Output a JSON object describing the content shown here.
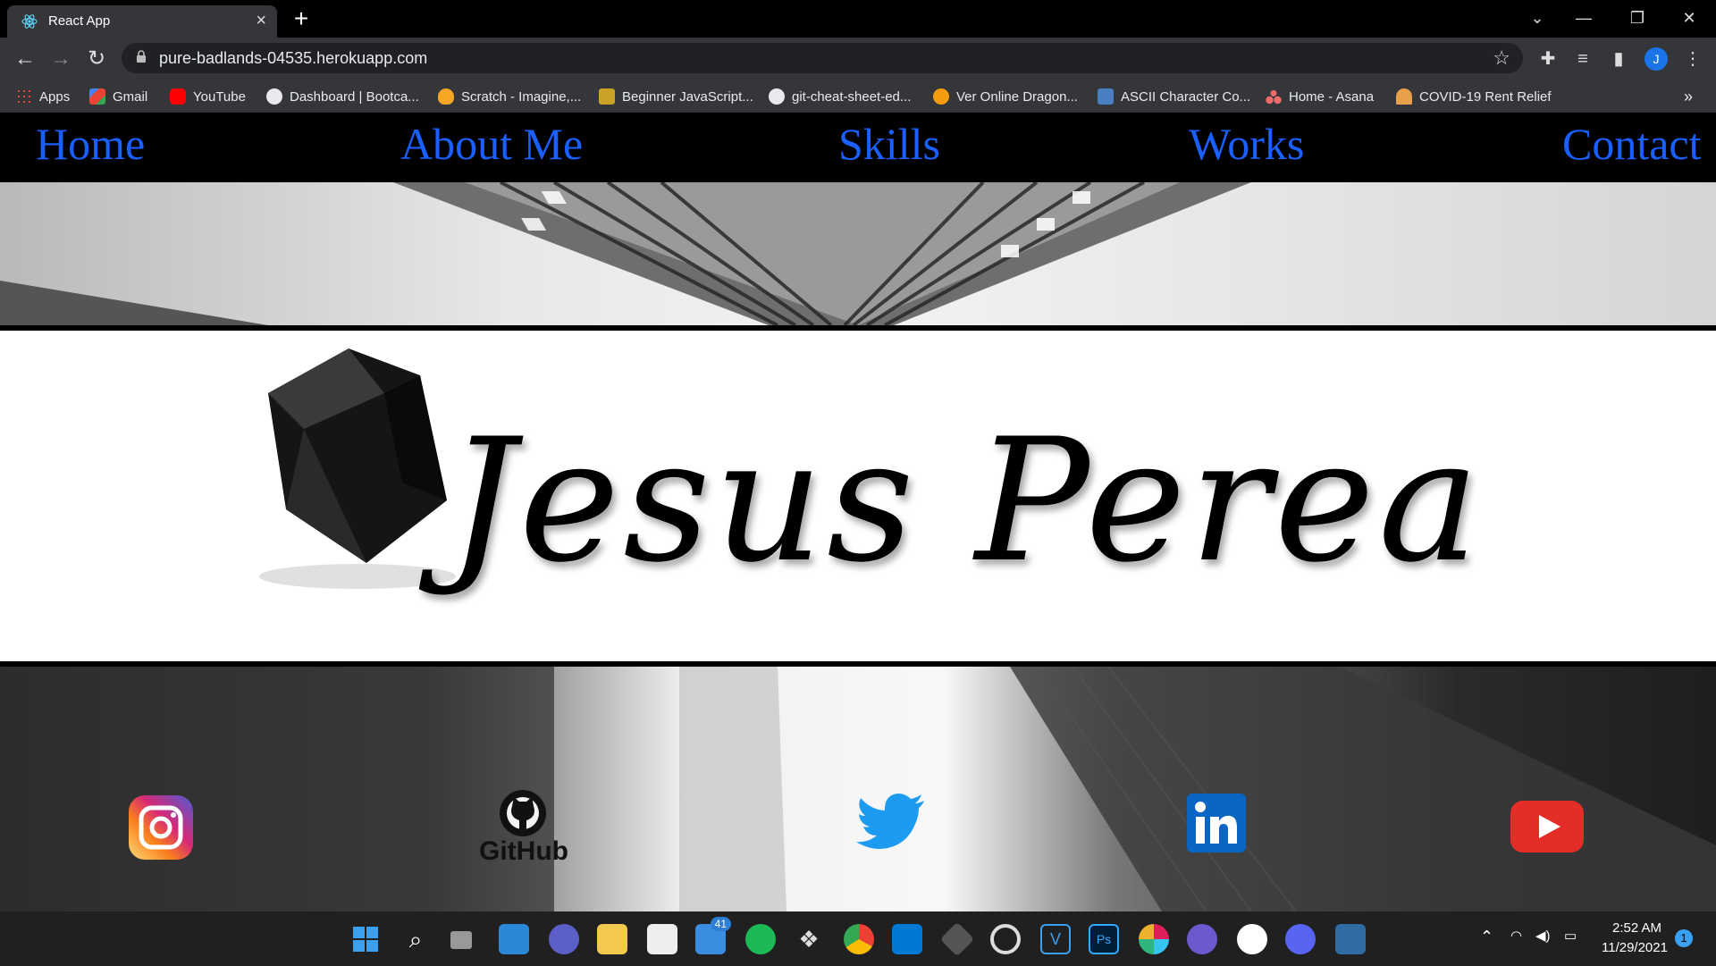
{
  "browser": {
    "tab_title": "React App",
    "tab_close": "×",
    "new_tab": "+",
    "url": "pure-badlands-04535.herokuapp.com",
    "avatar_letter": "J",
    "window_controls": [
      "⌄",
      "—",
      "❐",
      "✕"
    ]
  },
  "bookmarks": [
    {
      "label": "Apps",
      "icon": "apps-grid-icon",
      "color": "#ea4335"
    },
    {
      "label": "Gmail",
      "icon": "gmail-icon",
      "color": "#ea4335"
    },
    {
      "label": "YouTube",
      "icon": "youtube-icon",
      "color": "#ff0000"
    },
    {
      "label": "Dashboard | Bootca...",
      "icon": "globe-icon",
      "color": "#e8eaed"
    },
    {
      "label": "Scratch - Imagine,...",
      "icon": "scratch-icon",
      "color": "#f5a623"
    },
    {
      "label": "Beginner JavaScript...",
      "icon": "crown-icon",
      "color": "#c9a227"
    },
    {
      "label": "git-cheat-sheet-ed...",
      "icon": "github-icon",
      "color": "#e8eaed"
    },
    {
      "label": "Ver Online Dragon...",
      "icon": "dragonball-icon",
      "color": "#f39c12"
    },
    {
      "label": "ASCII Character Co...",
      "icon": "ascii-icon",
      "color": "#4a7fc1"
    },
    {
      "label": "Home - Asana",
      "icon": "asana-icon",
      "color": "#f06a6a"
    },
    {
      "label": "COVID-19 Rent Relief",
      "icon": "covid-relief-icon",
      "color": "#e8a04a"
    }
  ],
  "bookmarks_overflow": "»",
  "site": {
    "nav": [
      "Home",
      "About Me",
      "Skills",
      "Works",
      "Contact"
    ],
    "logo_text": "Jesus Perea",
    "social": [
      "instagram",
      "github",
      "twitter",
      "linkedin",
      "youtube"
    ],
    "github_label": "GitHub",
    "link_color": "#1a5fff"
  },
  "taskbar": {
    "mail_badge": "41",
    "time": "2:52 AM",
    "date": "11/29/2021",
    "notification_count": "1"
  }
}
